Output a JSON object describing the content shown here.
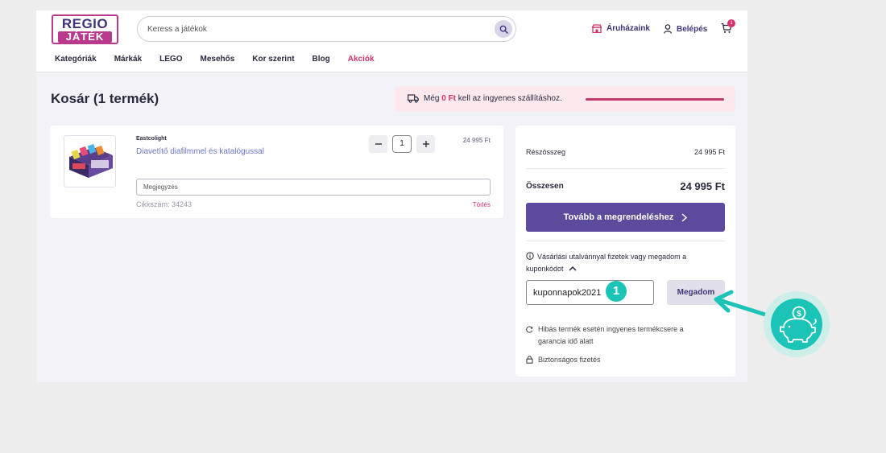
{
  "header": {
    "logo_line1": "REGIO",
    "logo_line2": "JÁTÉK",
    "search_placeholder": "Keress a játékok",
    "stores_label": "Áruházaink",
    "login_label": "Belépés",
    "cart_count": "1"
  },
  "nav": {
    "items": [
      "Kategóriák",
      "Márkák",
      "LEGO",
      "Mesehős",
      "Kor szerint",
      "Blog"
    ],
    "sale": "Akciók"
  },
  "page": {
    "title": "Kosár (1 termék)"
  },
  "shipping": {
    "prefix": "Még ",
    "amount": "0 Ft",
    "suffix": " kell az ingyenes szállításhoz.",
    "progress": 1.0
  },
  "item": {
    "brand": "Eastcolight",
    "name": "Diavetítő diafilmmel és katalógussal",
    "quantity": "1",
    "price": "24 995 Ft",
    "note_placeholder": "Megjegyzés",
    "sku": "Cikkszám: 34243",
    "delete_label": "Törlés"
  },
  "summary": {
    "subtotal_label": "Részösszeg",
    "subtotal_value": "24 995 Ft",
    "total_label": "Összesen",
    "total_value": "24 995 Ft",
    "checkout_label": "Tovább a megrendeléshez",
    "voucher_text": "Vásárlási utalvánnyal fizetek vagy megadom a kuponkódot",
    "coupon_value": "kuponnapok2021",
    "apply_label": "Megadom",
    "step_number": "1",
    "info_exchange": "Hibás termék esetén ingyenes termékcsere a garancia idő alatt",
    "info_secure": "Biztonságos fizetés"
  },
  "colors": {
    "brand_purple": "#41337a",
    "accent_pink": "#d6336c",
    "cta_purple": "#5d4a9c",
    "teal": "#1cc4b8"
  }
}
